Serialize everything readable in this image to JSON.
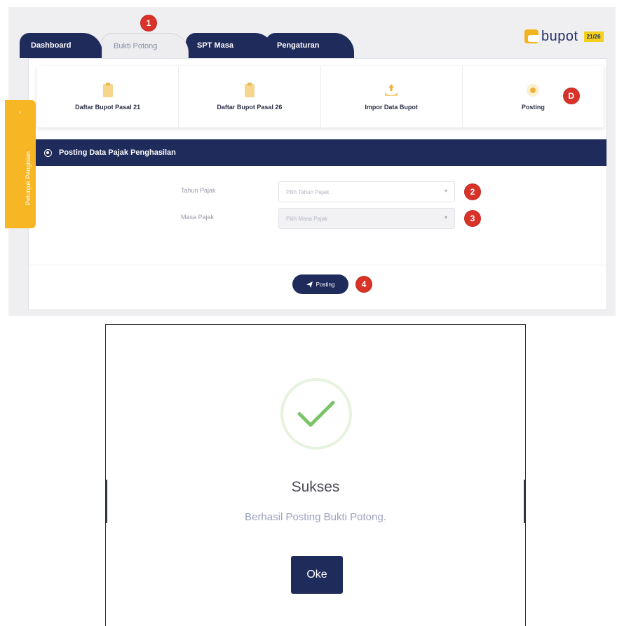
{
  "tabs": [
    {
      "label": "Dashboard"
    },
    {
      "label": "Bukti Potong"
    },
    {
      "label": "SPT Masa"
    },
    {
      "label": "Pengaturan"
    }
  ],
  "logo": {
    "text": "bupot",
    "badge": "21/26"
  },
  "menu": [
    {
      "label": "Daftar Bupot Pasal 21",
      "icon": "document-icon"
    },
    {
      "label": "Daftar Bupot Pasal 26",
      "icon": "document-icon"
    },
    {
      "label": "Impor Data Bupot",
      "icon": "upload-icon"
    },
    {
      "label": "Posting",
      "icon": "posting-icon"
    }
  ],
  "side_tab": {
    "label": "Petunjuk Pengisian"
  },
  "section_header": "Posting Data Pajak Penghasilan",
  "form": {
    "tahun": {
      "label": "Tahun Pajak",
      "placeholder": "Pilih Tahun Pajak"
    },
    "masa": {
      "label": "Masa Pajak",
      "placeholder": "Pilih Masa Pajak"
    }
  },
  "posting_button": "Posting",
  "badges": {
    "b1": "1",
    "b2": "2",
    "b3": "3",
    "b4": "4",
    "bD": "D"
  },
  "modal": {
    "title": "Sukses",
    "message": "Berhasil Posting Bukti Potong.",
    "ok_label": "Oke"
  },
  "colors": {
    "navy": "#1f2b5b",
    "accent": "#f7b624",
    "badge": "#d93329",
    "success": "#7cc36a"
  }
}
